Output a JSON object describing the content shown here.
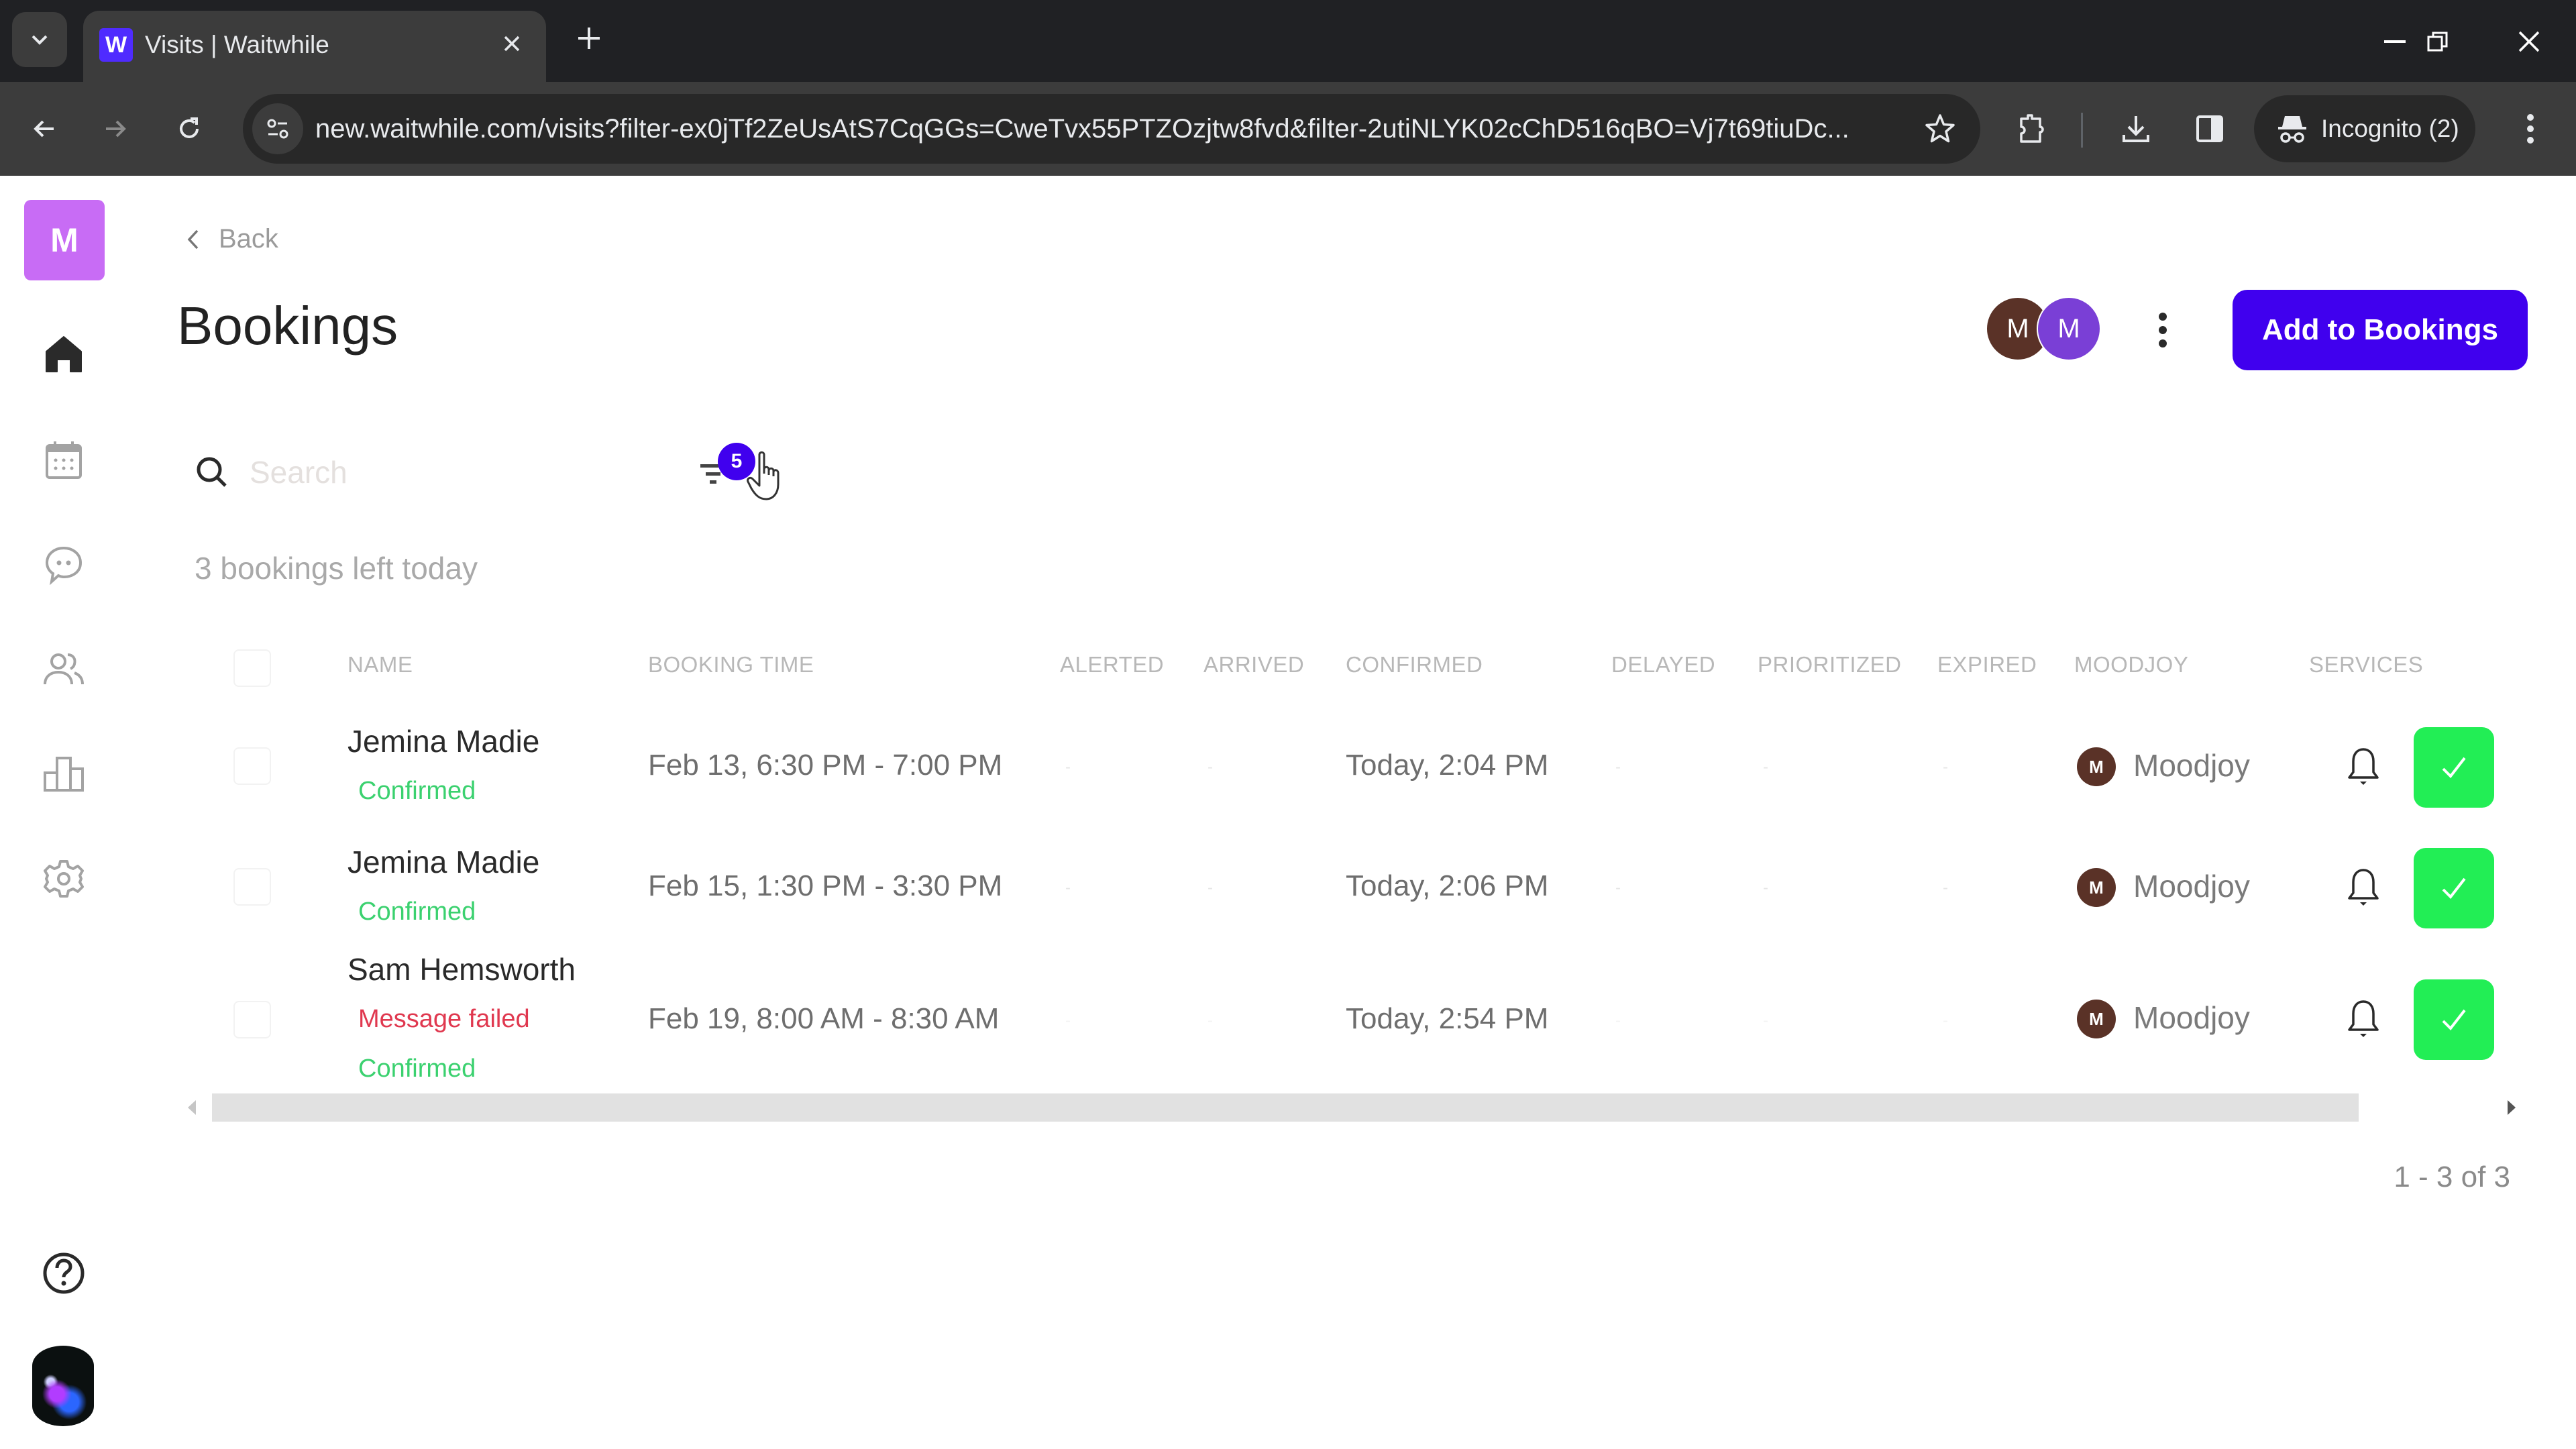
{
  "browser": {
    "tab_title": "Visits | Waitwhile",
    "favicon_letter": "W",
    "url": "new.waitwhile.com/visits?filter-ex0jTf2ZeUsAtS7CqGGs=CweTvx55PTZOzjtw8fvd&filter-2utiNLYK02cChD516qBO=Vj7t69tiuDc...",
    "incognito_label": "Incognito (2)",
    "icons": [
      "tab-search-icon",
      "close-icon",
      "plus-icon",
      "minimize-icon",
      "restore-icon",
      "window-close-icon",
      "back-arrow-icon",
      "forward-arrow-icon",
      "reload-icon",
      "site-info-icon",
      "star-icon",
      "extensions-icon",
      "download-icon",
      "side-panel-icon",
      "incognito-icon",
      "more-vert-icon"
    ]
  },
  "sidebar": {
    "org_initial": "M",
    "items": [
      {
        "name": "home",
        "icon": "home-icon",
        "active": true
      },
      {
        "name": "calendar",
        "icon": "calendar-icon",
        "active": false
      },
      {
        "name": "messages",
        "icon": "chat-icon",
        "active": false
      },
      {
        "name": "customers",
        "icon": "users-icon",
        "active": false
      },
      {
        "name": "analytics",
        "icon": "bar-chart-icon",
        "active": false
      },
      {
        "name": "settings",
        "icon": "gear-icon",
        "active": false
      }
    ],
    "help_icon": "help-icon"
  },
  "header": {
    "back_label": "Back",
    "title": "Bookings",
    "avatars": [
      {
        "initial": "M",
        "color": "#5a3227"
      },
      {
        "initial": "M",
        "color": "#7a3fd6"
      }
    ],
    "primary_button": "Add to Bookings",
    "accent_color": "#4000ee"
  },
  "search": {
    "placeholder": "Search",
    "value": ""
  },
  "filter": {
    "active_count": "5"
  },
  "summary": "3 bookings left today",
  "table": {
    "columns": [
      "NAME",
      "BOOKING TIME",
      "ALERTED",
      "ARRIVED",
      "CONFIRMED",
      "DELAYED",
      "PRIORITIZED",
      "EXPIRED",
      "MOODJOY",
      "SERVICES"
    ],
    "rows": [
      {
        "name": "Jemina Madie",
        "tags": [
          {
            "label": "Confirmed",
            "status": "success"
          }
        ],
        "booking_time": "Feb 13, 6:30 PM - 7:00 PM",
        "alerted": "-",
        "arrived": "-",
        "confirmed": "Today, 2:04 PM",
        "delayed": "-",
        "prioritized": "-",
        "expired": "-",
        "moodjoy_initial": "M",
        "moodjoy": "Moodjoy",
        "services": "-"
      },
      {
        "name": "Jemina Madie",
        "tags": [
          {
            "label": "Confirmed",
            "status": "success"
          }
        ],
        "booking_time": "Feb 15, 1:30 PM - 3:30 PM",
        "alerted": "-",
        "arrived": "-",
        "confirmed": "Today, 2:06 PM",
        "delayed": "-",
        "prioritized": "-",
        "expired": "-",
        "moodjoy_initial": "M",
        "moodjoy": "Moodjoy",
        "services": "-"
      },
      {
        "name": "Sam Hemsworth",
        "tags": [
          {
            "label": "Message failed",
            "status": "error"
          },
          {
            "label": "Confirmed",
            "status": "success"
          }
        ],
        "booking_time": "Feb 19, 8:00 AM - 8:30 AM",
        "alerted": "-",
        "arrived": "-",
        "confirmed": "Today, 2:54 PM",
        "delayed": "-",
        "prioritized": "-",
        "expired": "-",
        "moodjoy_initial": "M",
        "moodjoy": "Moodjoy",
        "services": "-"
      }
    ]
  },
  "pagination": "1 - 3 of 3",
  "colors": {
    "success": "#3bd16f",
    "error": "#e0384f",
    "serve_button": "#22ee55",
    "org_logo": "#c86cf5"
  }
}
